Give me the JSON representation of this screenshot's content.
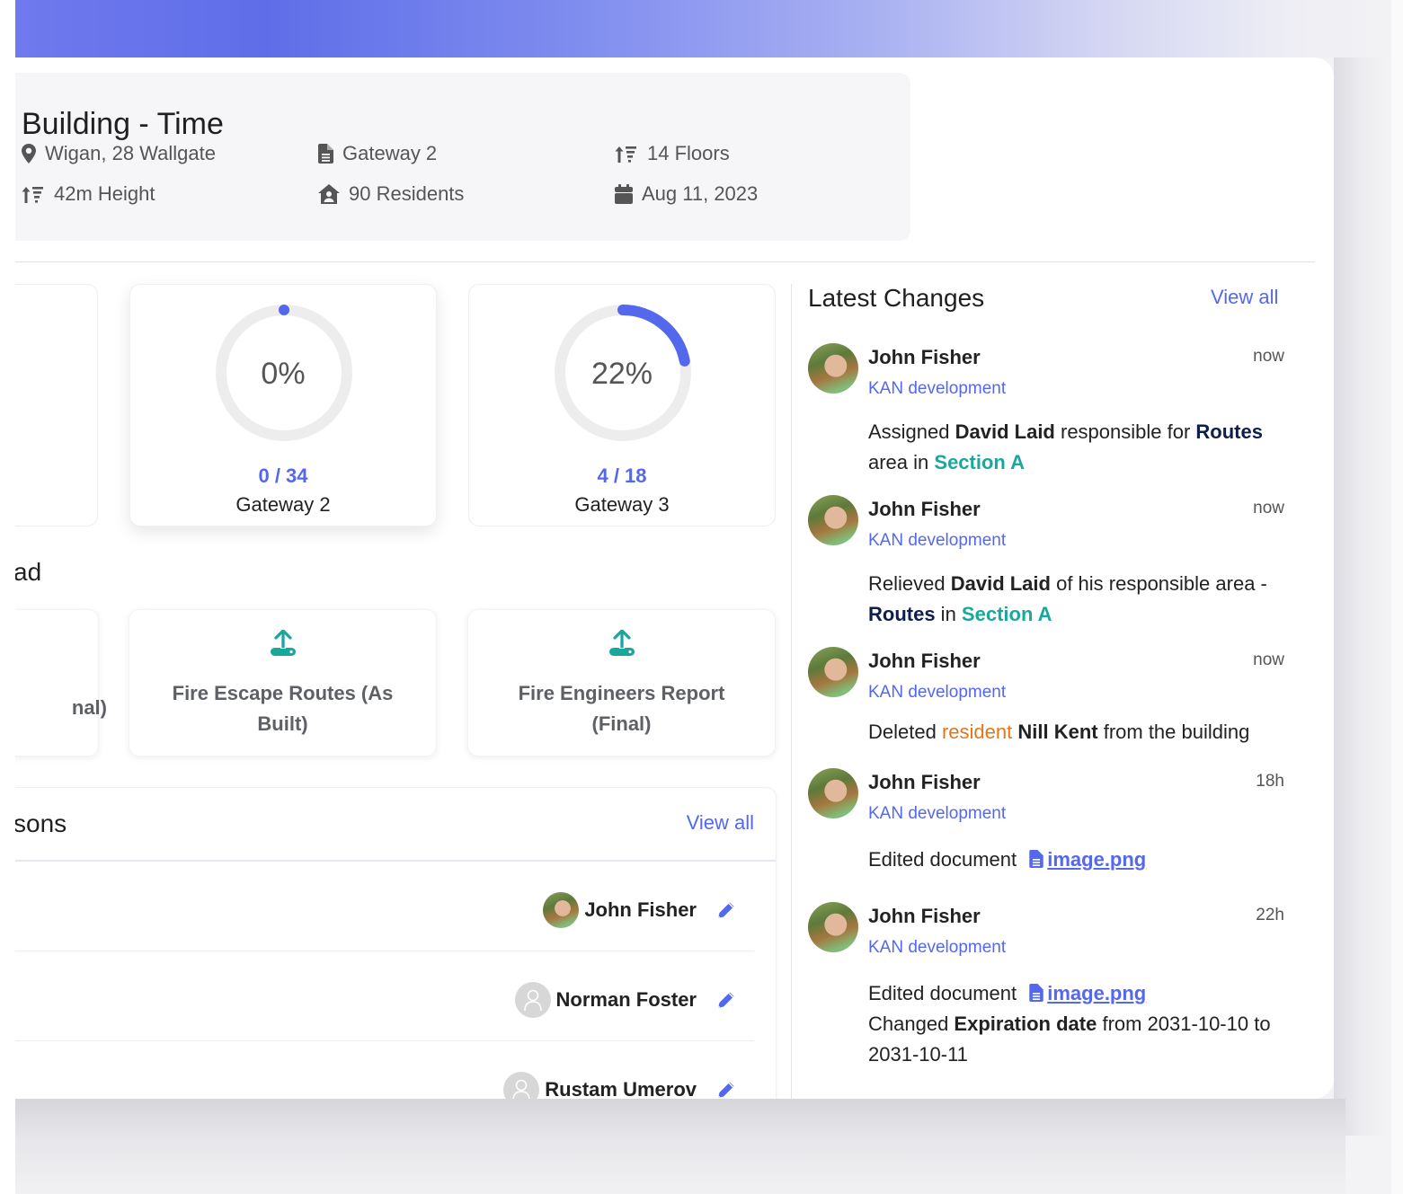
{
  "building": {
    "title": "Building - Time",
    "location": "Wigan, 28 Wallgate",
    "gateway": "Gateway 2",
    "floors": "14 Floors",
    "height": "42m Height",
    "residents": "90 Residents",
    "date": "Aug 11, 2023"
  },
  "stats": [
    {
      "percent_label": "0%",
      "progress": 0.0,
      "fraction": "0 / 34",
      "name": "Gateway 2"
    },
    {
      "percent_label": "22%",
      "progress": 0.22,
      "fraction": "4 / 18",
      "name": "Gateway 3"
    }
  ],
  "upload": {
    "heading_partial": "ad",
    "partial_card_label": "nal)",
    "cards": [
      {
        "label": "Fire Escape Routes (As Built)",
        "icon": "upload-icon"
      },
      {
        "label": "Fire Engineers Report (Final)",
        "icon": "upload-icon"
      }
    ]
  },
  "persons": {
    "heading_partial": "sons",
    "view_all": "View all",
    "rows": [
      {
        "name": "John Fisher",
        "avatar": "photo"
      },
      {
        "name": "Norman Foster",
        "avatar": "blank"
      },
      {
        "name": "Rustam Umerov",
        "avatar": "blank"
      }
    ]
  },
  "changes": {
    "heading": "Latest Changes",
    "view_all": "View all",
    "items": [
      {
        "user": "John Fisher",
        "org": "KAN development",
        "time": "now",
        "parts": [
          {
            "t": "Assigned "
          },
          {
            "t": "David Laid",
            "s": "b"
          },
          {
            "t": " responsible for "
          },
          {
            "t": "Routes",
            "s": "navy"
          },
          {
            "t": " area in "
          },
          {
            "t": "Section A",
            "s": "teal"
          }
        ]
      },
      {
        "user": "John Fisher",
        "org": "KAN development",
        "time": "now",
        "parts": [
          {
            "t": "Relieved "
          },
          {
            "t": "David Laid",
            "s": "b"
          },
          {
            "t": " of his responsible area - "
          },
          {
            "t": "Routes",
            "s": "navy"
          },
          {
            "t": " in "
          },
          {
            "t": "Section A",
            "s": "teal"
          }
        ]
      },
      {
        "user": "John Fisher",
        "org": "KAN development",
        "time": "now",
        "parts": [
          {
            "t": "Deleted "
          },
          {
            "t": "resident",
            "s": "orange"
          },
          {
            "t": " "
          },
          {
            "t": "Nill Kent",
            "s": "b"
          },
          {
            "t": " from the building"
          }
        ]
      },
      {
        "user": "John Fisher",
        "org": "KAN development",
        "time": "18h",
        "parts": [
          {
            "t": "Edited document "
          },
          {
            "t": "image.png",
            "s": "doc"
          }
        ]
      },
      {
        "user": "John Fisher",
        "org": "KAN development",
        "time": "22h",
        "parts": [
          {
            "t": "Edited document "
          },
          {
            "t": "image.png",
            "s": "doc"
          },
          {
            "t": "\n"
          },
          {
            "t": "Changed "
          },
          {
            "t": "Expiration date",
            "s": "b"
          },
          {
            "t": " from 2031-10-10 to 2031-10-11"
          }
        ]
      }
    ]
  },
  "colors": {
    "accent": "#5468ee",
    "teal": "#1aa89e",
    "navy": "#0f1f4d",
    "orange": "#e0761c",
    "ring_track": "#ededed"
  }
}
